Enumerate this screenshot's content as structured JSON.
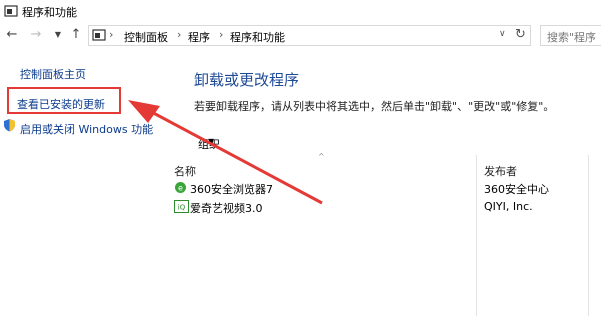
{
  "window": {
    "title": "程序和功能"
  },
  "nav": {
    "back_icon": "back-arrow-icon",
    "forward_icon": "forward-arrow-icon",
    "recent_icon": "chevron-down-icon",
    "up_icon": "up-arrow-icon",
    "breadcrumbs": [
      "控制面板",
      "程序",
      "程序和功能"
    ],
    "search_placeholder": "搜索\"程序"
  },
  "sidebar": {
    "home": "控制面板主页",
    "updates": "查看已安装的更新",
    "features": "启用或关闭 Windows 功能"
  },
  "main": {
    "heading": "卸载或更改程序",
    "description": "若要卸载程序，请从列表中将其选中，然后单击\"卸载\"、\"更改\"或\"修复\"。",
    "organize": "组织"
  },
  "columns": {
    "name": "名称",
    "publisher": "发布者"
  },
  "programs": [
    {
      "name": "360安全浏览器7",
      "publisher": "360安全中心",
      "icon": "360-browser-icon"
    },
    {
      "name": "爱奇艺视频3.0",
      "publisher": "QIYI, Inc.",
      "icon": "iqiyi-icon"
    }
  ],
  "colors": {
    "link": "#0b3b8c",
    "heading": "#1e4a96",
    "highlight": "#e53935"
  }
}
